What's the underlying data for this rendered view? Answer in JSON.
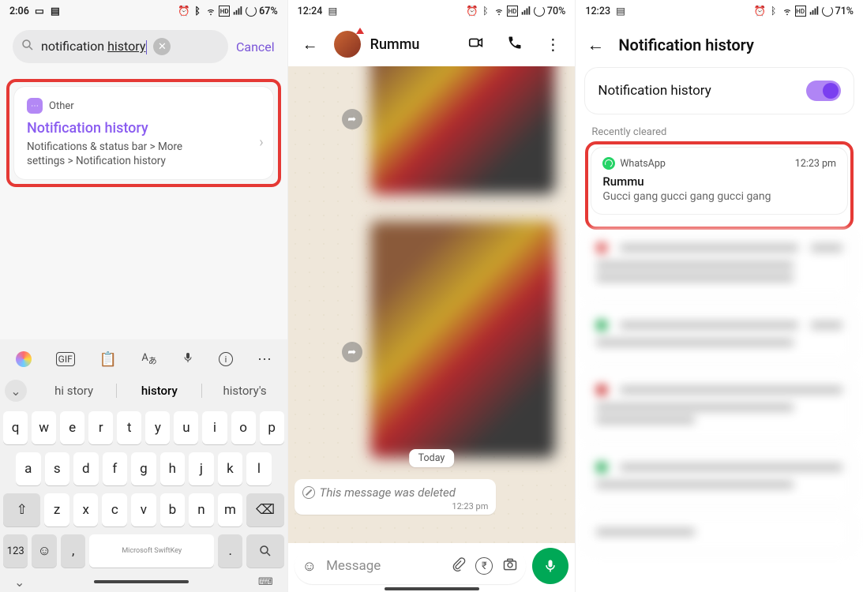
{
  "phone1": {
    "status": {
      "time": "2:06",
      "battery": "67%"
    },
    "search": {
      "value": "notification history",
      "cancel": "Cancel"
    },
    "result": {
      "section": "Other",
      "title": "Notification history",
      "path": "Notifications & status bar > More settings > Notification history"
    },
    "suggestions": {
      "a": "hi story",
      "b": "history",
      "c": "history's"
    },
    "keys": {
      "r1": [
        "q",
        "w",
        "e",
        "r",
        "t",
        "y",
        "u",
        "i",
        "o",
        "p"
      ],
      "r2": [
        "a",
        "s",
        "d",
        "f",
        "g",
        "h",
        "j",
        "k",
        "l"
      ],
      "r3": [
        "z",
        "x",
        "c",
        "v",
        "b",
        "n",
        "m"
      ],
      "num": "123",
      "space": "Microsoft SwiftKey"
    }
  },
  "phone2": {
    "status": {
      "time": "12:24",
      "battery": "70%"
    },
    "chat": {
      "name": "Rummu",
      "date_pill": "Today",
      "deleted_text": "This message was deleted",
      "deleted_time": "12:23 pm",
      "input_placeholder": "Message"
    }
  },
  "phone3": {
    "status": {
      "time": "12:23",
      "battery": "71%"
    },
    "page_title": "Notification history",
    "toggle_card": "Notification history",
    "section_label": "Recently cleared",
    "item": {
      "app": "WhatsApp",
      "time": "12:23 pm",
      "title": "Rummu",
      "body": "Gucci gang gucci gang gucci gang"
    }
  }
}
